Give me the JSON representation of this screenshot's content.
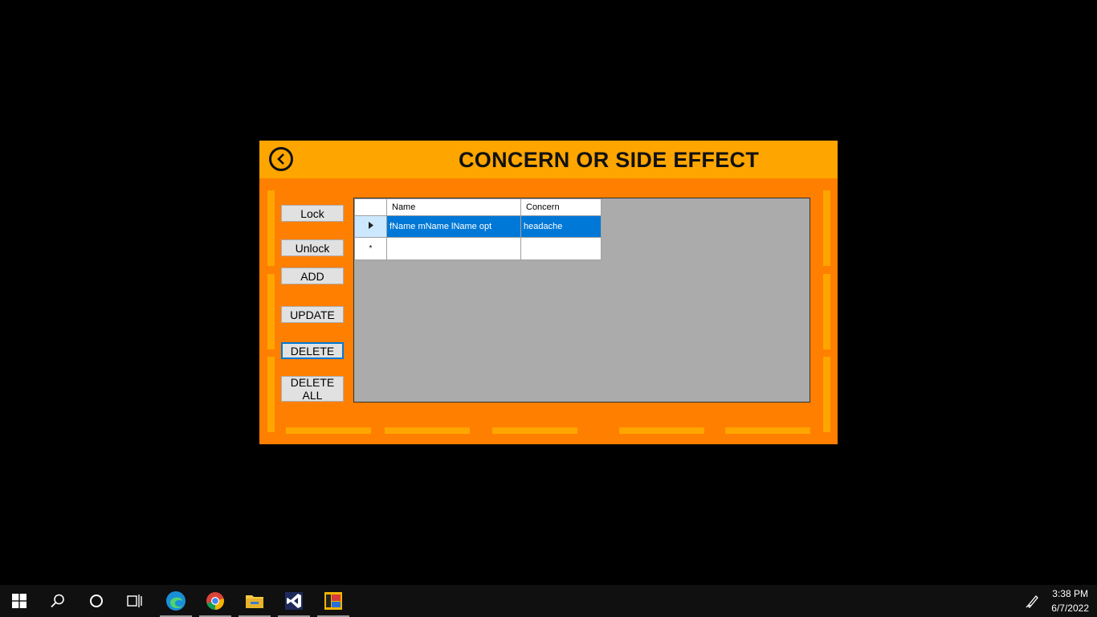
{
  "window": {
    "title": "CONCERN OR SIDE EFFECT",
    "accent_color": "#ffa500",
    "background_color": "#ff7f00"
  },
  "buttons": {
    "lock": "Lock",
    "unlock": "Unlock",
    "add": "ADD",
    "update": "UPDATE",
    "delete": "DELETE",
    "delete_all_line1": "DELETE",
    "delete_all_line2": "ALL"
  },
  "grid": {
    "columns": [
      "Name",
      "Concern"
    ],
    "rows": [
      {
        "name": "fName mName lName opt",
        "concern": "headache",
        "selected": true
      }
    ],
    "new_row_marker": "*"
  },
  "taskbar": {
    "icons": [
      "windows-start-icon",
      "search-icon",
      "cortana-icon",
      "task-view-icon",
      "edge-icon",
      "chrome-icon",
      "file-explorer-icon",
      "visual-studio-icon",
      "app-icon"
    ],
    "time": "3:38 PM",
    "date": "6/7/2022"
  }
}
